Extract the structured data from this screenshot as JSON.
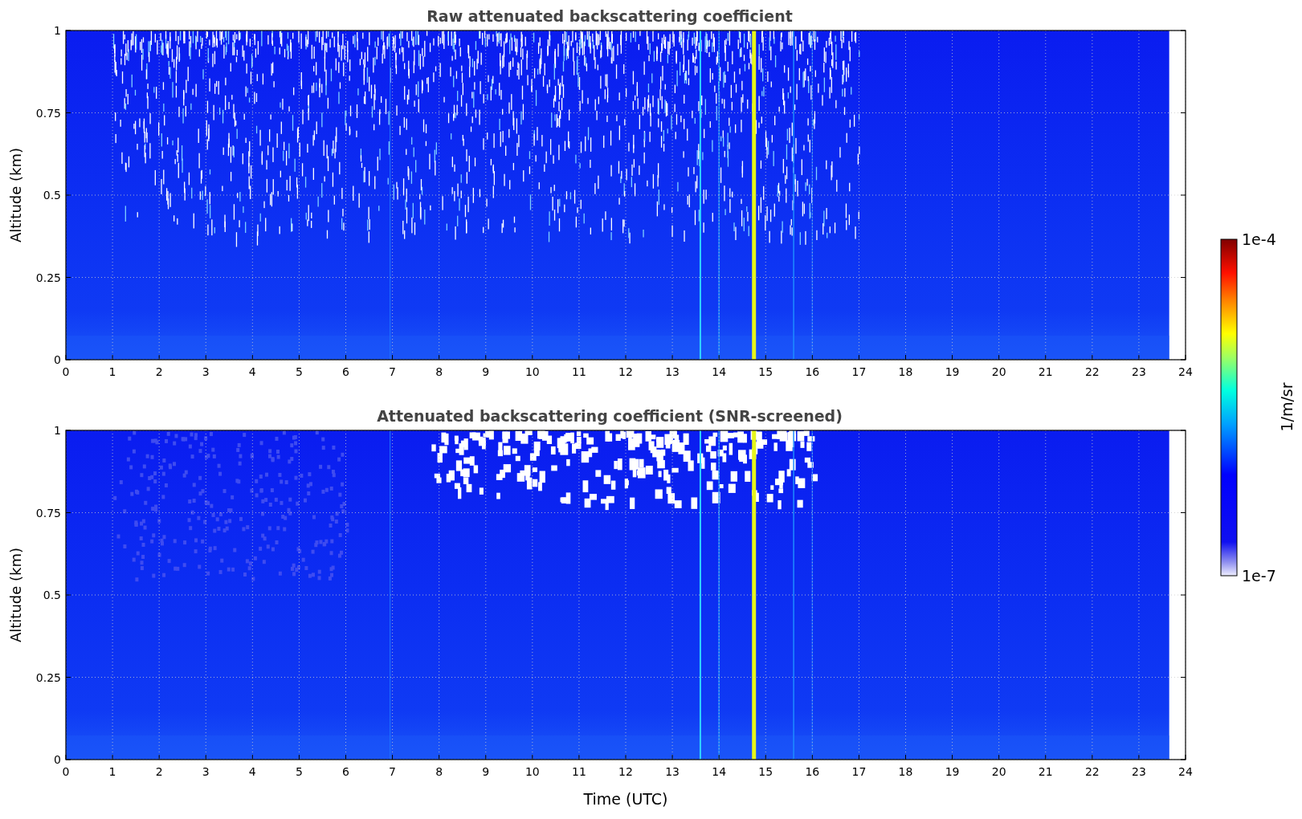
{
  "panels": [
    {
      "title": "Raw attenuated backscattering coefficient",
      "ylabel": "Altitude (km)",
      "yticks": [
        "1",
        "0.75",
        "0.5",
        "0.25",
        "0"
      ],
      "xticks": [
        "0",
        "1",
        "2",
        "3",
        "4",
        "5",
        "6",
        "7",
        "8",
        "9",
        "10",
        "11",
        "12",
        "13",
        "14",
        "15",
        "16",
        "17",
        "18",
        "19",
        "20",
        "21",
        "22",
        "23",
        "24"
      ],
      "kind": "raw"
    },
    {
      "title": "Attenuated backscattering coefficient (SNR-screened)",
      "ylabel": "Altitude (km)",
      "yticks": [
        "1",
        "0.75",
        "0.5",
        "0.25",
        "0"
      ],
      "xticks": [
        "0",
        "1",
        "2",
        "3",
        "4",
        "5",
        "6",
        "7",
        "8",
        "9",
        "10",
        "11",
        "12",
        "13",
        "14",
        "15",
        "16",
        "17",
        "18",
        "19",
        "20",
        "21",
        "22",
        "23",
        "24"
      ],
      "xlabel": "Time (UTC)",
      "kind": "screened"
    }
  ],
  "colorbar": {
    "max_label": "1e-4",
    "min_label": "1e-7",
    "label": "1/m/sr"
  }
}
